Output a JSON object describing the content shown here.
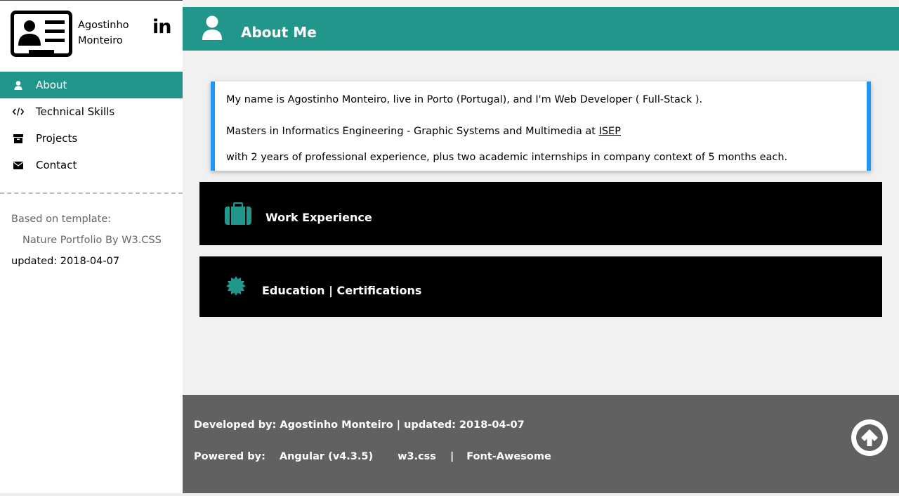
{
  "sidebar": {
    "brand_name": "Agostinho Monteiro",
    "linkedin_text": "in",
    "nav": [
      {
        "label": "About",
        "icon": "user-icon",
        "active": true
      },
      {
        "label": "Technical Skills",
        "icon": "code-icon",
        "active": false
      },
      {
        "label": "Projects",
        "icon": "archive-icon",
        "active": false
      },
      {
        "label": "Contact",
        "icon": "envelope-icon",
        "active": false
      }
    ],
    "credits": {
      "based_on": "Based on template:",
      "template_name": "Nature Portfolio By W3.CSS",
      "updated": "updated: 2018-04-07"
    }
  },
  "header": {
    "title": "About Me",
    "icon": "user-icon"
  },
  "about": {
    "line1": "My name is Agostinho Monteiro, live in Porto (Portugal), and I'm Web Developer ( Full-Stack ).",
    "line2_prefix": "Masters in Informatics Engineering - Graphic Systems and Multimedia at ",
    "line2_link": "ISEP",
    "line3": "with 2 years of professional experience, plus two academic internships in company context of 5 months each."
  },
  "panels": {
    "work_label": "Work Experience",
    "work_icon": "briefcase-icon",
    "education_label": "Education | Certifications",
    "education_icon": "certificate-icon"
  },
  "footer": {
    "developed_by": "Developed by: Agostinho Monteiro | updated: 2018-04-07",
    "powered_label": "Powered by:",
    "powered_angular": "Angular (v4.3.5)",
    "powered_w3css": "w3.css",
    "separator": "|",
    "powered_fa": "Font-Awesome",
    "scroll_top_icon": "arrow-circle-up-icon"
  },
  "colors": {
    "accent": "#21978b",
    "card_border": "#2196f3",
    "footer_bg": "#616161",
    "panel_bg": "#000000"
  }
}
